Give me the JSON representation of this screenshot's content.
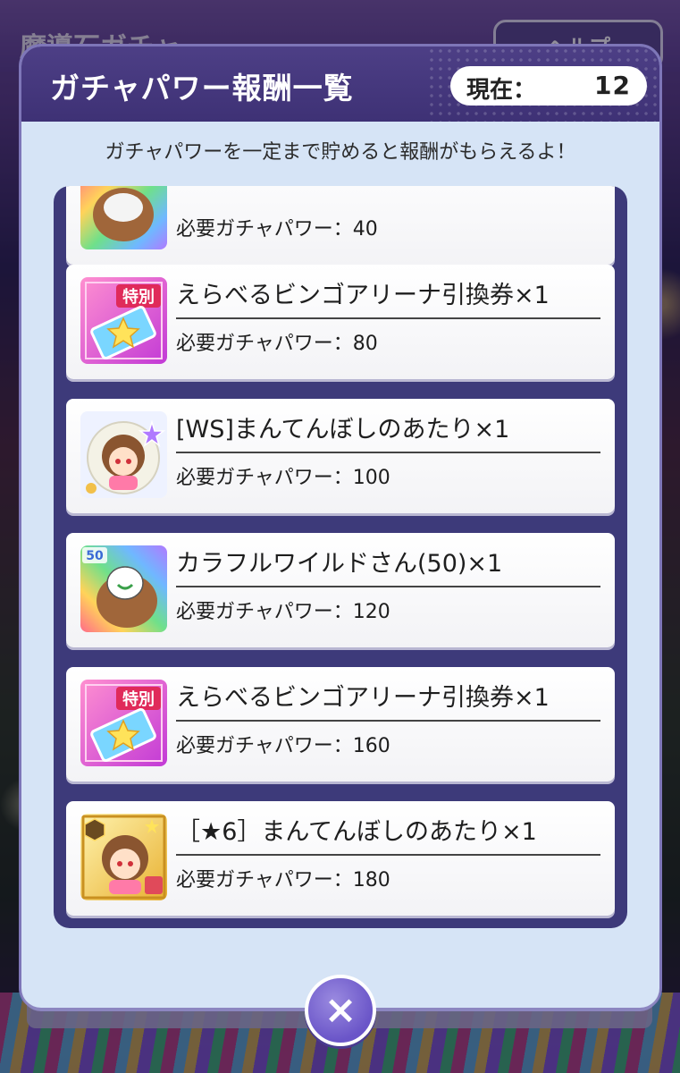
{
  "background": {
    "title": "魔導石ガチャ",
    "help_label": "ヘルプ"
  },
  "modal": {
    "title": "ガチャパワー報酬一覧",
    "current_label": "現在：",
    "current_value": "12",
    "subtitle": "ガチャパワーを一定まで貯めると報酬がもらえるよ！",
    "rewards": [
      {
        "name": "",
        "requirement": "必要ガチャパワー：40",
        "icon": "colorful-wild-icon"
      },
      {
        "name": "えらべるビンゴアリーナ引換券×1",
        "requirement": "必要ガチャパワー：80",
        "icon": "ticket-icon",
        "badge": "特別"
      },
      {
        "name": "[WS]まんてんぼしのあたり×1",
        "requirement": "必要ガチャパワー：100",
        "icon": "character-ws-icon"
      },
      {
        "name": "カラフルワイルドさん(50)×1",
        "requirement": "必要ガチャパワー：120",
        "icon": "colorful-wild-icon",
        "badge": "50"
      },
      {
        "name": "えらべるビンゴアリーナ引換券×1",
        "requirement": "必要ガチャパワー：160",
        "icon": "ticket-icon",
        "badge": "特別"
      },
      {
        "name": "［★6］まんてんぼしのあたり×1",
        "requirement": "必要ガチャパワー：180",
        "icon": "character-star6-icon"
      }
    ],
    "close_label": "×"
  },
  "colors": {
    "header": "#3e3175",
    "panel": "#d6e4f6",
    "list_frame": "#3d3a7a",
    "close_button": "#6a55c8"
  }
}
